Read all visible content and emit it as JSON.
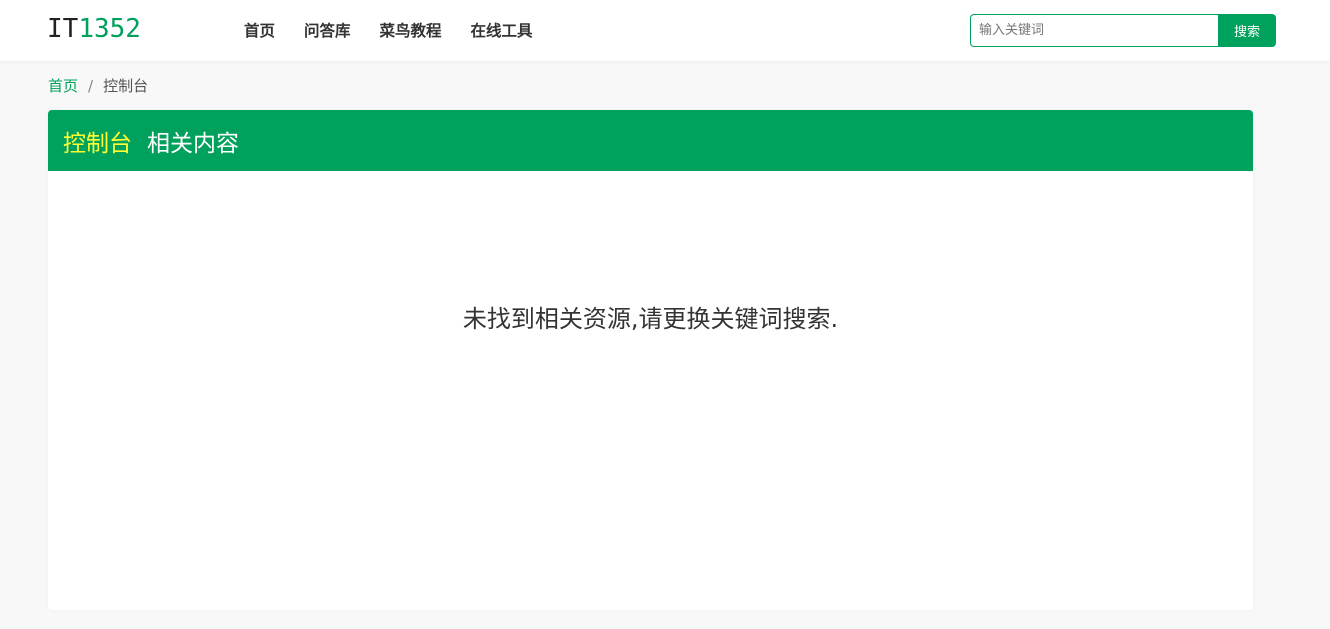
{
  "header": {
    "logo": {
      "part1": "IT",
      "part2": "1352"
    },
    "nav": [
      {
        "label": "首页"
      },
      {
        "label": "问答库"
      },
      {
        "label": "菜鸟教程"
      },
      {
        "label": "在线工具"
      }
    ],
    "search": {
      "placeholder": "输入关键词",
      "value": "",
      "button_label": "搜索"
    }
  },
  "breadcrumb": {
    "home": "首页",
    "separator": "/",
    "current": "控制台"
  },
  "panel": {
    "keyword": "控制台",
    "title_suffix": "相关内容",
    "empty_message": "未找到相关资源,请更换关键词搜索."
  },
  "colors": {
    "brand_green": "#00a15c",
    "keyword_yellow": "#ffff33"
  }
}
